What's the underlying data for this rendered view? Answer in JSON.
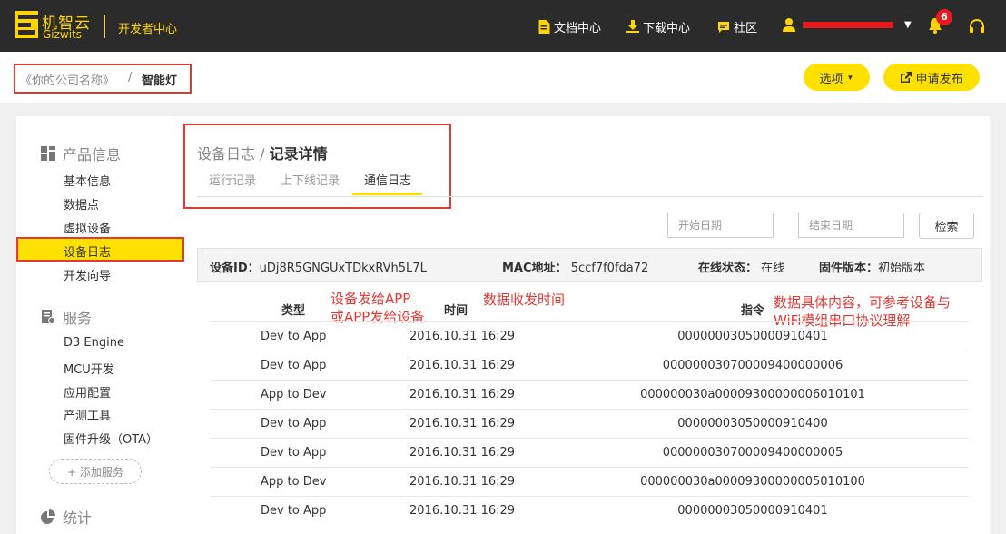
{
  "topbar": {
    "logo_cn": "机智云",
    "logo_en": "Gizwits",
    "dev_center": "开发者中心",
    "nav": [
      {
        "label": "文档中心",
        "icon": "document-icon"
      },
      {
        "label": "下载中心",
        "icon": "download-icon"
      },
      {
        "label": "社区",
        "icon": "chat-icon"
      }
    ],
    "notifications": "6"
  },
  "breadcrumb": {
    "company": "《你的公司名称》",
    "separator": "/",
    "product": "智能灯"
  },
  "actions": {
    "options": "选项",
    "publish": "申请发布"
  },
  "sidebar": {
    "groups": [
      {
        "label": "产品信息",
        "items": [
          "基本信息",
          "数据点",
          "虚拟设备",
          "设备日志",
          "开发向导"
        ]
      },
      {
        "label": "服务",
        "items": [
          "D3 Engine",
          "MCU开发",
          "应用配置",
          "产测工具",
          "固件升级（OTA）"
        ]
      },
      {
        "label": "统计",
        "items": []
      }
    ],
    "add_service": "+ 添加服务"
  },
  "content": {
    "title_prefix": "设备日志 / ",
    "title": "记录详情",
    "tabs": [
      "运行记录",
      "上下线记录",
      "通信日志"
    ],
    "active_tab": 2,
    "start_date_placeholder": "开始日期",
    "end_date_placeholder": "结束日期",
    "search": "检索"
  },
  "device_info": {
    "device_id_label": "设备ID：",
    "device_id": "uDj8R5GNGUxTDkxRVh5L7L",
    "mac_label": "MAC地址：",
    "mac": "5ccf7f0fda72",
    "status_label": "在线状态：",
    "status": "在线",
    "firmware_label": "固件版本：",
    "firmware": "初始版本"
  },
  "table": {
    "headers": [
      "类型",
      "时间",
      "指令"
    ],
    "rows": [
      [
        "Dev to App",
        "2016.10.31 16:29",
        "0000000305000091040 1"
      ],
      [
        "Dev to App",
        "2016.10.31 16:29",
        "0000000307000094000000 06"
      ],
      [
        "App to Dev",
        "2016.10.31 16:29",
        "000000030a00009300000006010101"
      ],
      [
        "Dev to App",
        "2016.10.31 16:29",
        "00000003050000910400"
      ],
      [
        "Dev to App",
        "2016.10.31 16:29",
        "00000003070000940000000 5"
      ],
      [
        "App to Dev",
        "2016.10.31 16:29",
        "000000030a00009300000005010100"
      ],
      [
        "Dev to App",
        "2016.10.31 16:29",
        "00000003050000910401"
      ]
    ]
  },
  "annotations": {
    "type_note_1": "设备发给APP",
    "type_note_2": "或APP发给设备",
    "time_note": "数据收发时间",
    "cmd_note_1": "数据具体内容，可参考设备与",
    "cmd_note_2": "WiFi模组串口协议理解"
  },
  "colors": {
    "accent": "#ffe100",
    "topbar": "#2b2b2b",
    "annotation": "#e53935"
  }
}
